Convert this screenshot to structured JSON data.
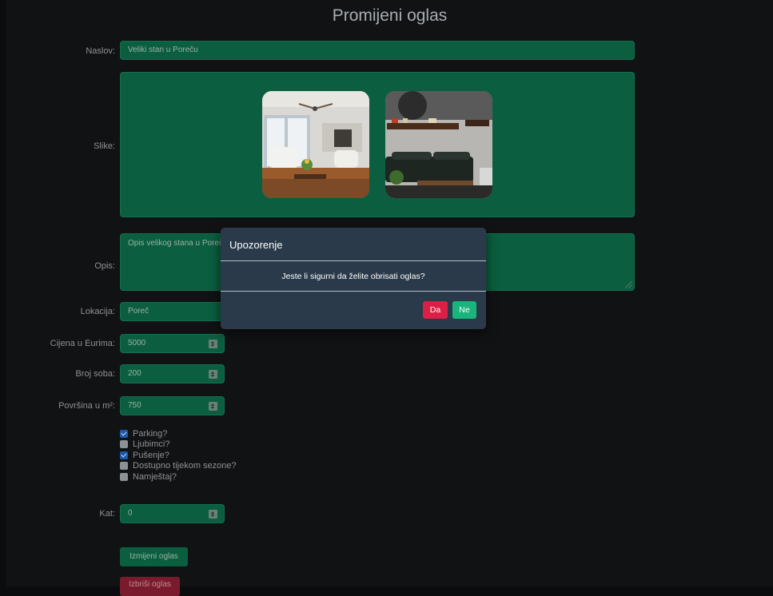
{
  "page_title": "Promijeni oglas",
  "form": {
    "naslov": {
      "label": "Naslov:",
      "value": "Veliki stan u Poreču"
    },
    "slike": {
      "label": "Slike:"
    },
    "opis": {
      "label": "Opis:",
      "value": "Opis velikog stana u Poreču"
    },
    "lokacija": {
      "label": "Lokacija:",
      "value": "Poreč"
    },
    "cijena": {
      "label": "Cijena u Eurima:",
      "value": "5000"
    },
    "broj_soba": {
      "label": "Broj soba:",
      "value": "200"
    },
    "povrsina": {
      "label": "Površina u m²:",
      "value": "750"
    },
    "checkboxes": [
      {
        "label": "Parking?",
        "checked": true
      },
      {
        "label": "Ljubimci?",
        "checked": false
      },
      {
        "label": "Pušenje?",
        "checked": true
      },
      {
        "label": "Dostupno tijekom sezone?",
        "checked": false
      },
      {
        "label": "Namještaj?",
        "checked": false
      }
    ],
    "kat": {
      "label": "Kat:",
      "value": "0"
    },
    "submit_label": "Izmijeni oglas",
    "delete_label": "Izbriši oglas"
  },
  "modal": {
    "title": "Upozorenje",
    "message": "Jeste li sigurni da želite obrisati oglas?",
    "yes_label": "Da",
    "no_label": "Ne"
  },
  "colors": {
    "field_bg": "#0b5e3f",
    "yes_btn": "#dc1f47",
    "no_btn": "#19b57b",
    "modal_bg": "#2a3a4a"
  }
}
